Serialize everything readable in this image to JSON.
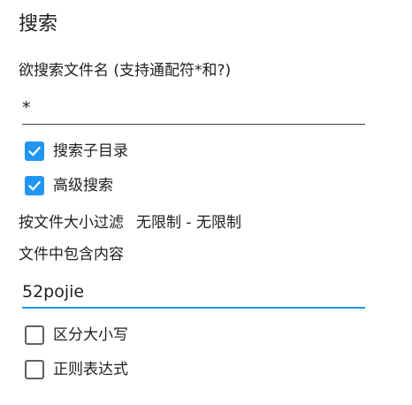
{
  "dialog": {
    "title": "搜索"
  },
  "filename": {
    "label": "欲搜索文件名 (支持通配符*和?)",
    "value": "*"
  },
  "options": {
    "subdirs": {
      "label": "搜索子目录",
      "checked": true
    },
    "advanced": {
      "label": "高级搜索",
      "checked": true
    }
  },
  "size_filter": {
    "label": "按文件大小过滤",
    "value": "无限制 - 无限制"
  },
  "content": {
    "label": "文件中包含内容",
    "value": "52pojie"
  },
  "content_options": {
    "case_sensitive": {
      "label": "区分大小写",
      "checked": false
    },
    "regex": {
      "label": "正则表达式",
      "checked": false
    }
  },
  "colors": {
    "accent": "#2196f3",
    "text": "#212121"
  }
}
